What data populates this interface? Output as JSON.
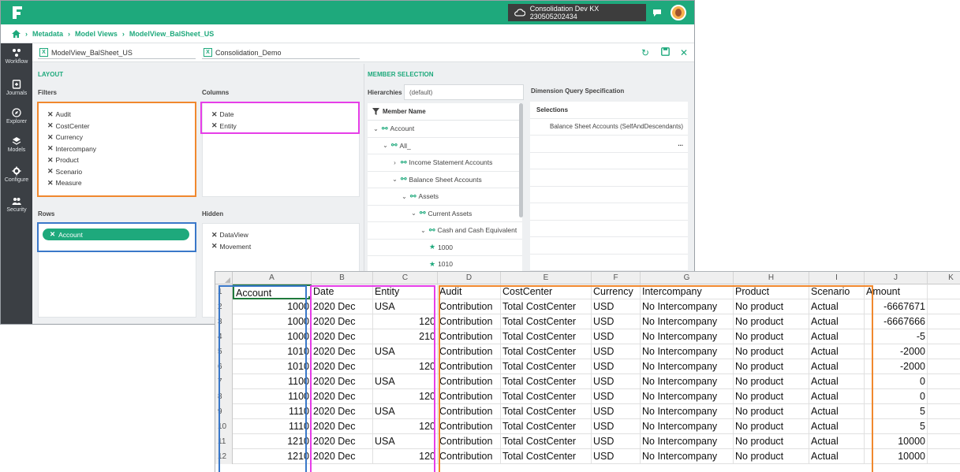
{
  "topbar": {
    "environment": "Consolidation Dev KX 230505202434"
  },
  "breadcrumb": [
    "Metadata",
    "Model Views",
    "ModelView_BalSheet_US"
  ],
  "sidebar": {
    "items": [
      {
        "label": "Workflow",
        "icon": "workflow-icon"
      },
      {
        "label": "Journals",
        "icon": "journals-icon"
      },
      {
        "label": "Explorer",
        "icon": "explorer-icon"
      },
      {
        "label": "Models",
        "icon": "models-icon"
      },
      {
        "label": "Configure",
        "icon": "configure-icon"
      },
      {
        "label": "Security",
        "icon": "security-icon"
      }
    ]
  },
  "docbar": {
    "model_view": "ModelView_BalSheet_US",
    "application": "Consolidation_Demo"
  },
  "layout": {
    "title": "LAYOUT",
    "filters_label": "Filters",
    "filters": [
      "Audit",
      "CostCenter",
      "Currency",
      "Intercompany",
      "Product",
      "Scenario",
      "Measure"
    ],
    "columns_label": "Columns",
    "columns": [
      "Date",
      "Entity"
    ],
    "rows_label": "Rows",
    "rows": [
      "Account"
    ],
    "hidden_label": "Hidden",
    "hidden": [
      "DataView",
      "Movement"
    ]
  },
  "member_selection": {
    "title": "MEMBER SELECTION",
    "hierarchies_label": "Hierarchies",
    "hierarchy_value": "(default)",
    "member_name_header": "Member Name",
    "tree": [
      {
        "label": "Account",
        "level": 1,
        "expanded": true,
        "type": "hier"
      },
      {
        "label": "All_",
        "level": 2,
        "expanded": true,
        "type": "hier"
      },
      {
        "label": "Income Statement Accounts",
        "level": 3,
        "expanded": false,
        "type": "hier"
      },
      {
        "label": "Balance Sheet Accounts",
        "level": 3,
        "expanded": true,
        "type": "hier"
      },
      {
        "label": "Assets",
        "level": 4,
        "expanded": true,
        "type": "hier"
      },
      {
        "label": "Current Assets",
        "level": 5,
        "expanded": true,
        "type": "hier"
      },
      {
        "label": "Cash and Cash Equivalent",
        "level": 6,
        "expanded": true,
        "type": "hier"
      },
      {
        "label": "1000",
        "level": 7,
        "type": "leaf"
      },
      {
        "label": "1010",
        "level": 7,
        "type": "leaf"
      }
    ],
    "dq_title": "Dimension Query Specification",
    "selections_header": "Selections",
    "selections": [
      "Balance Sheet Accounts (SelfAndDescendants)"
    ],
    "more_label": "..."
  },
  "sheet": {
    "columns": [
      "A",
      "B",
      "C",
      "D",
      "E",
      "F",
      "G",
      "H",
      "I",
      "J",
      "K"
    ],
    "header": [
      "Account",
      "Date",
      "Entity",
      "Audit",
      "CostCenter",
      "Currency",
      "Intercompany",
      "Product",
      "Scenario",
      "Amount"
    ],
    "rows": [
      [
        "1000",
        "2020 Dec",
        "USA",
        "Contribution",
        "Total CostCenter",
        "USD",
        "No Intercompany",
        "No product",
        "Actual",
        "-6667671"
      ],
      [
        "1000",
        "2020 Dec",
        "120",
        "Contribution",
        "Total CostCenter",
        "USD",
        "No Intercompany",
        "No product",
        "Actual",
        "-6667666"
      ],
      [
        "1000",
        "2020 Dec",
        "210",
        "Contribution",
        "Total CostCenter",
        "USD",
        "No Intercompany",
        "No product",
        "Actual",
        "-5"
      ],
      [
        "1010",
        "2020 Dec",
        "USA",
        "Contribution",
        "Total CostCenter",
        "USD",
        "No Intercompany",
        "No product",
        "Actual",
        "-2000"
      ],
      [
        "1010",
        "2020 Dec",
        "120",
        "Contribution",
        "Total CostCenter",
        "USD",
        "No Intercompany",
        "No product",
        "Actual",
        "-2000"
      ],
      [
        "1100",
        "2020 Dec",
        "USA",
        "Contribution",
        "Total CostCenter",
        "USD",
        "No Intercompany",
        "No product",
        "Actual",
        "0"
      ],
      [
        "1100",
        "2020 Dec",
        "120",
        "Contribution",
        "Total CostCenter",
        "USD",
        "No Intercompany",
        "No product",
        "Actual",
        "0"
      ],
      [
        "1110",
        "2020 Dec",
        "USA",
        "Contribution",
        "Total CostCenter",
        "USD",
        "No Intercompany",
        "No product",
        "Actual",
        "5"
      ],
      [
        "1110",
        "2020 Dec",
        "120",
        "Contribution",
        "Total CostCenter",
        "USD",
        "No Intercompany",
        "No product",
        "Actual",
        "5"
      ],
      [
        "1210",
        "2020 Dec",
        "USA",
        "Contribution",
        "Total CostCenter",
        "USD",
        "No Intercompany",
        "No product",
        "Actual",
        "10000"
      ],
      [
        "1210",
        "2020 Dec",
        "120",
        "Contribution",
        "Total CostCenter",
        "USD",
        "No Intercompany",
        "No product",
        "Actual",
        "10000"
      ]
    ]
  },
  "colors": {
    "brand": "#1ea97c",
    "filters_highlight": "#f0882e",
    "columns_highlight": "#e63ee8",
    "rows_highlight": "#3a78c9"
  }
}
